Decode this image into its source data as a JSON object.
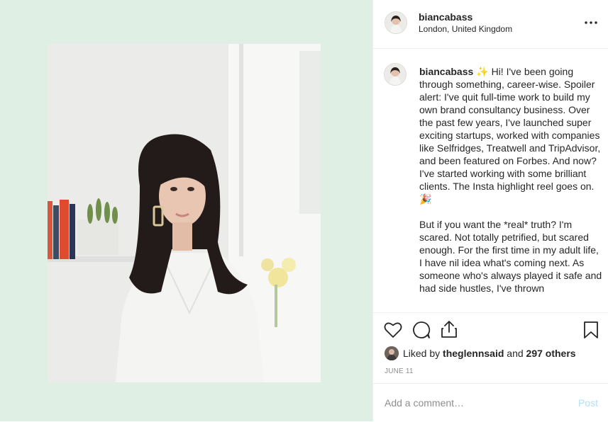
{
  "post": {
    "username": "biancabass",
    "location": "London, United Kingdom",
    "caption_paragraphs": [
      "✨ Hi! I've been going through something, career-wise. Spoiler alert: I've quit full-time work to build my own brand consultancy business. Over the past few years, I've launched super exciting startups, worked with companies like Selfridges, Treatwell and TripAdvisor, and been featured on Forbes. And now? I've started working with some brilliant clients. The Insta highlight reel goes on. 🎉",
      "But if you want the *real* truth? I'm scared. Not totally petrified, but scared enough. For the first time in my adult life, I have nil idea what's coming next. As someone who's always played it safe and had side hustles, I've thrown"
    ],
    "likes": {
      "prefix": "Liked by",
      "user": "theglennsaid",
      "joiner": "and",
      "others": "297 others"
    },
    "date": "JUNE 11"
  },
  "comment": {
    "placeholder": "Add a comment…",
    "post_label": "Post"
  },
  "icons": {
    "more": "more-options-icon",
    "like": "heart-icon",
    "comment": "comment-icon",
    "share": "share-icon",
    "save": "bookmark-icon"
  },
  "colors": {
    "media_background": "#dfefe3",
    "post_button_disabled": "#b2dffc",
    "secondary_text": "#8e8e8e"
  }
}
